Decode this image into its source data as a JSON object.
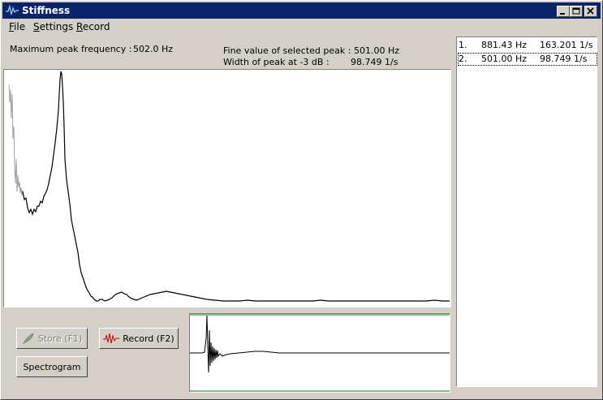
{
  "window": {
    "title": "Stiffness"
  },
  "menu": [
    {
      "label": "File",
      "accel": "F",
      "rest": "ile"
    },
    {
      "label": "Settings",
      "accel": "S",
      "rest": "ettings"
    },
    {
      "label": "Record",
      "accel": "R",
      "rest": "ecord"
    }
  ],
  "info": {
    "max_peak_label": "Maximum peak frequency :",
    "max_peak_value": "502.0 Hz",
    "fine_label": "Fine value of selected peak :",
    "fine_value": "501.00 Hz",
    "width_label": "Width of peak at -3 dB :",
    "width_value": "98.749 1/s"
  },
  "peaks": [
    {
      "index": "1.",
      "freq": "881.43 Hz",
      "width": "163.201 1/s"
    },
    {
      "index": "2.",
      "freq": "501.00 Hz",
      "width": "98.749 1/s"
    }
  ],
  "selected_peak_index": 1,
  "buttons": {
    "store": "Store (F1)",
    "record": "Record (F2)",
    "spectrogram": "Spectrogram"
  },
  "icons": [
    "waveform-icon",
    "minimize-icon",
    "maximize-icon",
    "close-icon",
    "feather-icon",
    "waveform-icon"
  ],
  "colors": {
    "titlebar": "#0a246a",
    "face": "#d4d0c8",
    "signal_baseline": "#008000",
    "record_icon": "#cc0000"
  }
}
